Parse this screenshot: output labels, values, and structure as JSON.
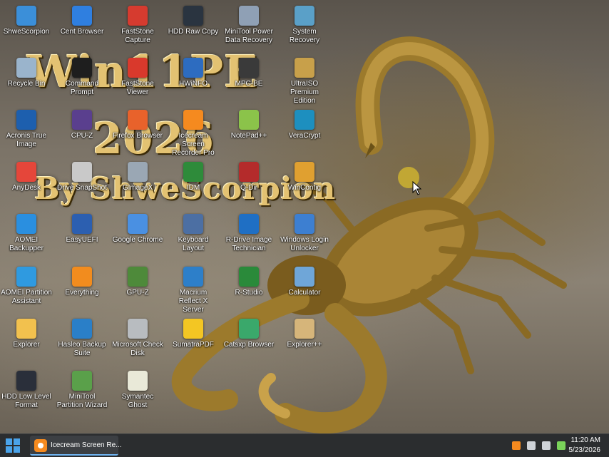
{
  "wallpaper": {
    "title_line1": "Win11PE",
    "title_line2": "2026",
    "title_line3": "By ShweScorpion"
  },
  "desktop_icons": [
    {
      "label": "ShweScorpion",
      "icon": "monitor-icon",
      "color": "#3b8fd9"
    },
    {
      "label": "Cent Browser",
      "icon": "cent-browser-icon",
      "color": "#2f7fe0"
    },
    {
      "label": "FastStone Capture",
      "icon": "faststone-capture-icon",
      "color": "#d63b2f"
    },
    {
      "label": "HDD Raw Copy",
      "icon": "hdd-raw-copy-icon",
      "color": "#2a3440"
    },
    {
      "label": "MiniTool Power Data Recovery",
      "icon": "minitool-recovery-icon",
      "color": "#8fa0b5"
    },
    {
      "label": "System Recovery",
      "icon": "system-recovery-icon",
      "color": "#5aa0c8"
    },
    {
      "label": "Recycle Bin",
      "icon": "recycle-bin-icon",
      "color": "#9ab4cc"
    },
    {
      "label": "Command Prompt",
      "icon": "command-prompt-icon",
      "color": "#1e1e1e"
    },
    {
      "label": "FastStone Viewer",
      "icon": "faststone-viewer-icon",
      "color": "#d9392c"
    },
    {
      "label": "HWiNFO",
      "icon": "hwinfo-icon",
      "color": "#2d6cc0"
    },
    {
      "label": "MPC-BE",
      "icon": "mpc-be-icon",
      "color": "#3a3a3a"
    },
    {
      "label": "UltraISO Premium Edition",
      "icon": "ultraiso-icon",
      "color": "#c8a04a"
    },
    {
      "label": "Acronis True Image",
      "icon": "acronis-icon",
      "color": "#1d5fae"
    },
    {
      "label": "CPU-Z",
      "icon": "cpu-z-icon",
      "color": "#5a3f8e"
    },
    {
      "label": "Firefox Browser",
      "icon": "firefox-icon",
      "color": "#e8622b"
    },
    {
      "label": "Icecream Screen Recorder Pro",
      "icon": "icecream-recorder-icon",
      "color": "#f58a1f"
    },
    {
      "label": "NotePad++",
      "icon": "notepad-plus-icon",
      "color": "#8bc34a"
    },
    {
      "label": "VeraCrypt",
      "icon": "veracrypt-icon",
      "color": "#1d8fbf"
    },
    {
      "label": "AnyDesk",
      "icon": "anydesk-icon",
      "color": "#e5463a"
    },
    {
      "label": "Drive SnapShot",
      "icon": "drive-snapshot-icon",
      "color": "#c9c9c9"
    },
    {
      "label": "GImageX",
      "icon": "gimagex-icon",
      "color": "#9aa7b4"
    },
    {
      "label": "IDM",
      "icon": "idm-icon",
      "color": "#2e8b3a"
    },
    {
      "label": "Q-Dir",
      "icon": "q-dir-icon",
      "color": "#b42b2b"
    },
    {
      "label": "WinContig",
      "icon": "wincontig-icon",
      "color": "#e0a030"
    },
    {
      "label": "AOMEI Backupper",
      "icon": "aomei-backupper-icon",
      "color": "#2a8fe0"
    },
    {
      "label": "EasyUEFI",
      "icon": "easyuefi-icon",
      "color": "#2c5fb0"
    },
    {
      "label": "Google Chrome",
      "icon": "chrome-icon",
      "color": "#4a90e2"
    },
    {
      "label": "Keyboard Layout",
      "icon": "keyboard-icon",
      "color": "#4c6fa3"
    },
    {
      "label": "R-Drive Image Technician",
      "icon": "r-drive-icon",
      "color": "#1f6fc4"
    },
    {
      "label": "Windows Login Unlocker",
      "icon": "login-unlocker-icon",
      "color": "#3d7fd1"
    },
    {
      "label": "AOMEI Partition Assistant",
      "icon": "aomei-partition-icon",
      "color": "#2f9ae0"
    },
    {
      "label": "Everything",
      "icon": "everything-search-icon",
      "color": "#f28c1e"
    },
    {
      "label": "GPU-Z",
      "icon": "gpu-z-icon",
      "color": "#4e8a3a"
    },
    {
      "label": "Macrium Reflect X Server",
      "icon": "macrium-icon",
      "color": "#2d7fc9"
    },
    {
      "label": "R-Studio",
      "icon": "r-studio-icon",
      "color": "#2a8a3a"
    },
    {
      "label": "Calculator",
      "icon": "calculator-icon",
      "color": "#6fa6d8"
    },
    {
      "label": "Explorer",
      "icon": "folder-icon",
      "color": "#f2c14e"
    },
    {
      "label": "Hasleo Backup Suite",
      "icon": "hasleo-icon",
      "color": "#2a7fc8"
    },
    {
      "label": "Microsoft Check Disk",
      "icon": "check-disk-icon",
      "color": "#b8bcc0"
    },
    {
      "label": "SumatraPDF",
      "icon": "sumatrapdf-icon",
      "color": "#f3c623"
    },
    {
      "label": "Catsxp Browser",
      "icon": "catsxp-browser-icon",
      "color": "#3aa86b"
    },
    {
      "label": "Explorer++",
      "icon": "explorer-plus-icon",
      "color": "#d6b57a"
    },
    {
      "label": "HDD Low Level Format",
      "icon": "hdd-low-level-icon",
      "color": "#2a2f3a"
    },
    {
      "label": "MiniTool Partition Wizard",
      "icon": "minitool-partition-icon",
      "color": "#5aa04a"
    },
    {
      "label": "Symantec Ghost",
      "icon": "ghost-icon",
      "color": "#e9e9d8"
    }
  ],
  "taskbar": {
    "start_label": "Start",
    "task_item_label": "Icecream Screen Re...",
    "clock_time": "11:20 AM",
    "clock_date": "5/23/2026",
    "tray_icons": [
      {
        "name": "icecream-tray-icon",
        "color": "#f58a1f"
      },
      {
        "name": "network-tray-icon",
        "color": "#cfd3d8"
      },
      {
        "name": "volume-tray-icon",
        "color": "#cfd3d8"
      },
      {
        "name": "color-tray-icon",
        "color": "#7ad35a"
      },
      {
        "name": "display-tray-icon",
        "color": "#e0e0e0"
      }
    ]
  },
  "colors": {
    "taskbar_bg": "#2b2d2f",
    "accent": "#4aa3ea",
    "wallpaper_gold": "#e3c272"
  }
}
